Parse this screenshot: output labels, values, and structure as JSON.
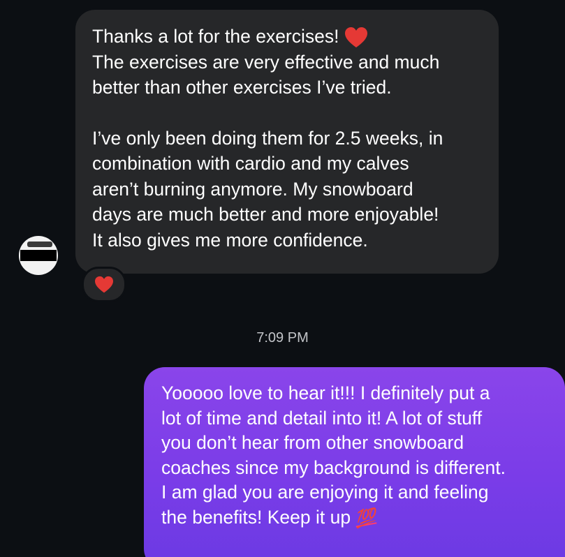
{
  "incoming_message": {
    "paragraph_1": "Thanks a lot for the exercises!",
    "paragraph_1_emoji": "red-heart",
    "paragraph_1_rest": "The exercises are very effective and much\nbetter than other exercises I’ve tried.",
    "paragraph_2": "I’ve only been doing them for 2.5 weeks, in\ncombination with cardio and my calves\naren’t burning anymore. My snowboard\ndays are much better and more enjoyable!\nIt also gives me more confidence.",
    "reaction_icon": "red-heart"
  },
  "timestamp": "7:09 PM",
  "outgoing_message": {
    "text": "Yooooo love to hear it!!! I definitely put a\nlot of time and detail into it! A lot of stuff\nyou don’t hear from other snowboard\ncoaches since my background is different.\nI am glad you are enjoying it and feeling\nthe benefits! Keep it up",
    "emoji": "💯",
    "emoji_icon": "hundred-points"
  },
  "colors": {
    "background": "#0c0f13",
    "incoming_bubble": "#262729",
    "outgoing_bubble_top": "#8a45ea",
    "outgoing_bubble_bottom": "#6b3ae3",
    "heart": "#e53935"
  }
}
